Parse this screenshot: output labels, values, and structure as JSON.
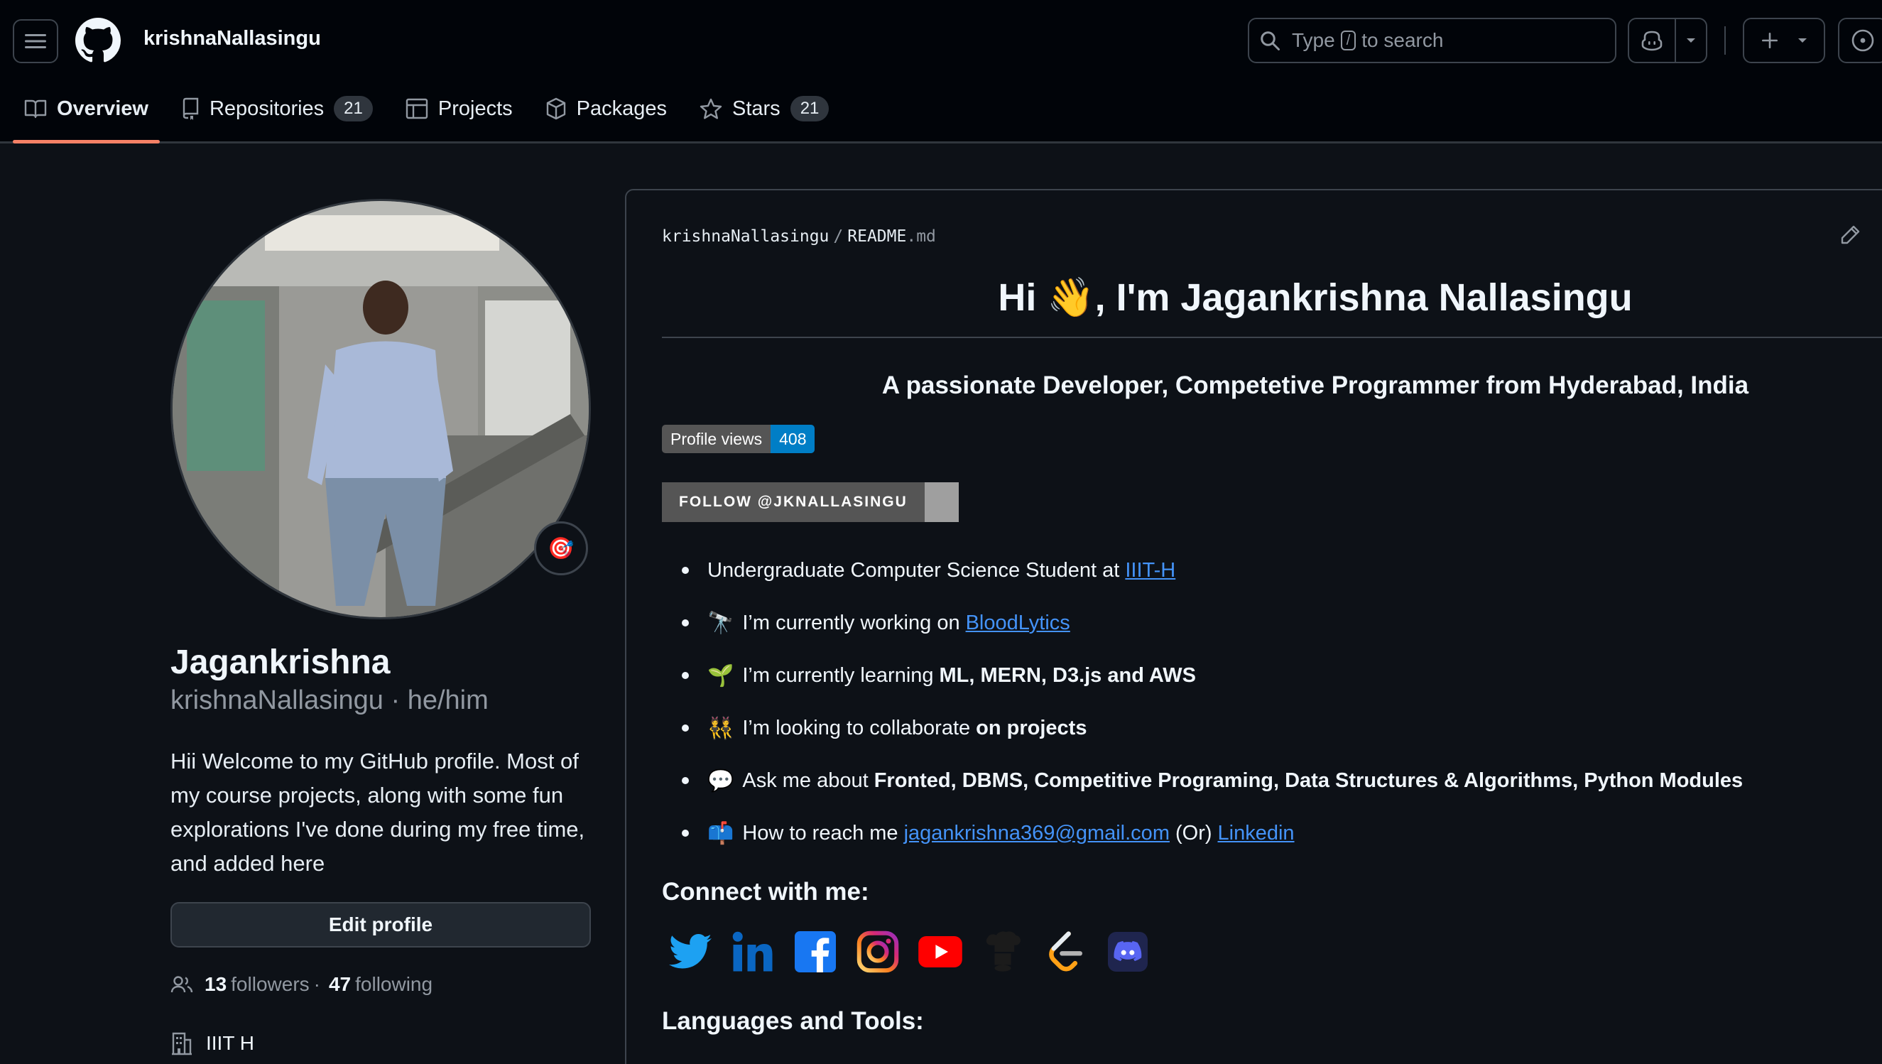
{
  "header": {
    "username": "krishnaNallasingu",
    "search_prefix": "Type",
    "search_key": "/",
    "search_suffix": "to search"
  },
  "tabs": [
    {
      "label": "Overview"
    },
    {
      "label": "Repositories",
      "count": "21"
    },
    {
      "label": "Projects"
    },
    {
      "label": "Packages"
    },
    {
      "label": "Stars",
      "count": "21"
    }
  ],
  "profile": {
    "status_emoji": "🎯",
    "name": "Jagankrishna",
    "login": "krishnaNallasingu",
    "pronouns": "he/him",
    "separator": "·",
    "bio": "Hii Welcome to my GitHub profile. Most of my course projects, along with some fun explorations I've done during my free time, and added here",
    "edit_label": "Edit profile",
    "followers_count": "13",
    "followers_label": "followers",
    "following_count": "47",
    "following_label": "following",
    "dot": "·",
    "org": "IIIT H"
  },
  "readme": {
    "owner": "krishnaNallasingu",
    "slash": "/",
    "file": "README",
    "ext": ".md",
    "heading": "Hi 👋, I'm Jagankrishna Nallasingu",
    "subheading": "A passionate Developer, Competetive Programmer from Hyderabad, India",
    "views_label": "Profile views",
    "views_count": "408",
    "follow_badge": "FOLLOW @JKNALLASINGU",
    "bullets": {
      "b1_text": "Undergraduate Computer Science Student at",
      "b1_link": "IIIT-H",
      "b2_emoji": "🔭",
      "b2_text": "I’m currently working on",
      "b2_link": "BloodLytics",
      "b3_emoji": "🌱",
      "b3_text": "I’m currently learning",
      "b3_bold": "ML, MERN, D3.js and AWS",
      "b4_emoji": "👯",
      "b4_text": "I’m looking to collaborate",
      "b4_bold": "on projects",
      "b5_emoji": "💬",
      "b5_text": "Ask me about",
      "b5_bold": "Fronted, DBMS, Competitive Programing, Data Structures & Algorithms, Python Modules",
      "b6_emoji": "📫",
      "b6_text": "How to reach me",
      "b6_link": "jagankrishna369@gmail.com",
      "b6_mid": "(Or)",
      "b6_link2": "Linkedin"
    },
    "connect_heading": "Connect with me:",
    "tools_heading": "Languages and Tools:"
  },
  "colors": {
    "accent_underline": "#f78166",
    "link": "#4493f8",
    "twitter": "#1da1f2",
    "linkedin": "#0a66c2",
    "facebook": "#1877f2",
    "youtube": "#ff0000",
    "discord": "#5865f2"
  },
  "icons": [
    "hamburger-icon",
    "github-logo-icon",
    "search-icon",
    "copilot-icon",
    "chevron-down-icon",
    "plus-icon",
    "issues-icon",
    "book-icon",
    "repo-icon",
    "table-icon",
    "package-icon",
    "star-icon",
    "pencil-icon",
    "people-icon",
    "building-icon",
    "twitter-icon",
    "linkedin-icon",
    "facebook-icon",
    "instagram-icon",
    "youtube-icon",
    "codechef-icon",
    "leetcode-icon",
    "discord-icon"
  ]
}
